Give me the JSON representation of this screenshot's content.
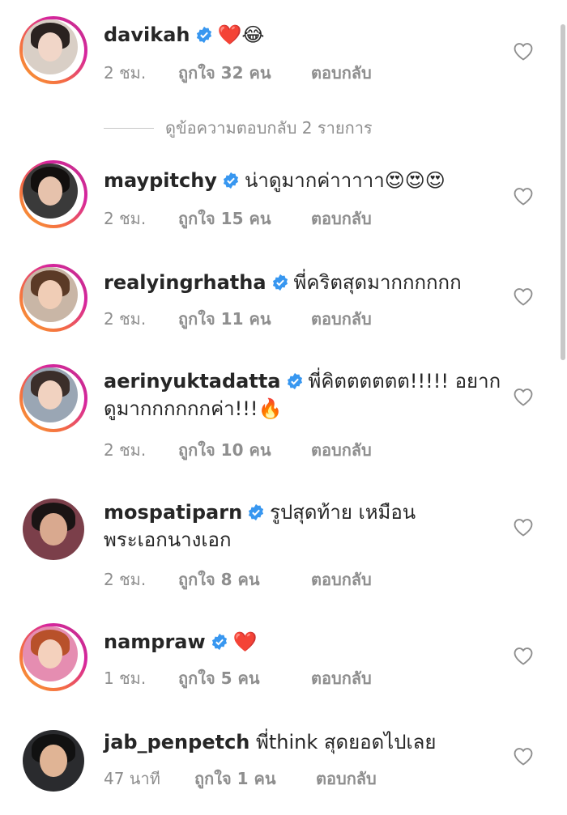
{
  "view_replies": "ดูข้อความตอบกลับ 2 รายการ",
  "comments": [
    {
      "username": "davikah",
      "verified": true,
      "text": "",
      "emoji": "❤️😂",
      "time": "2 ชม.",
      "likes": "ถูกใจ 32 คน",
      "reply": "ตอบกลับ"
    },
    {
      "username": "maypitchy",
      "verified": true,
      "text": "น่าดูมากค่าาาาา",
      "emoji": "😍😍😍",
      "time": "2 ชม.",
      "likes": "ถูกใจ 15 คน",
      "reply": "ตอบกลับ"
    },
    {
      "username": "realyingrhatha",
      "verified": true,
      "text": "พี่คริตสุดมากกกกกก",
      "emoji": "",
      "time": "2 ชม.",
      "likes": "ถูกใจ 11 คน",
      "reply": "ตอบกลับ"
    },
    {
      "username": "aerinyuktadatta",
      "verified": true,
      "text": "พี่คิตตตตตต!!!!! อยากดูมากกกกกกค่า!!!",
      "emoji": "🔥",
      "time": "2 ชม.",
      "likes": "ถูกใจ 10 คน",
      "reply": "ตอบกลับ"
    },
    {
      "username": "mospatiparn",
      "verified": true,
      "text": "รูปสุดท้าย เหมือนพระเอกนางเอก",
      "emoji": "",
      "time": "2 ชม.",
      "likes": "ถูกใจ 8 คน",
      "reply": "ตอบกลับ"
    },
    {
      "username": "nampraw",
      "verified": true,
      "text": "",
      "emoji": "❤️",
      "time": "1 ชม.",
      "likes": "ถูกใจ 5 คน",
      "reply": "ตอบกลับ"
    },
    {
      "username": "jab_penpetch",
      "verified": false,
      "text": "พี่think สุดยอดไปเลย",
      "emoji": "",
      "time": "47 นาที",
      "likes": "ถูกใจ 1 คน",
      "reply": "ตอบกลับ"
    }
  ],
  "colors": {
    "verified": "#3897f0",
    "muted": "#8e8e8e",
    "text": "#262626",
    "ring": "#d6249f"
  },
  "icons": {
    "verified": "verified-badge-icon",
    "like": "heart-outline-icon"
  }
}
